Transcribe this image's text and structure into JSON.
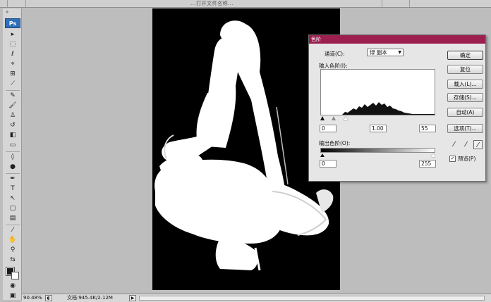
{
  "window": {
    "doc_title": "...打开文件名称..."
  },
  "toolbox": {
    "collapse": "»",
    "logo": "Ps",
    "tools": [
      {
        "name": "move-tool-icon",
        "glyph": "▸"
      },
      {
        "name": "marquee-tool-icon",
        "glyph": "⬚"
      },
      {
        "name": "lasso-tool-icon",
        "glyph": "ℓ"
      },
      {
        "name": "quick-select-tool-icon",
        "glyph": "⌖"
      },
      {
        "name": "crop-tool-icon",
        "glyph": "⊞"
      },
      {
        "name": "slice-tool-icon",
        "glyph": "⟋"
      },
      {
        "name": "healing-brush-icon",
        "glyph": "✎"
      },
      {
        "name": "brush-tool-icon",
        "glyph": "🖌"
      },
      {
        "name": "clone-stamp-icon",
        "glyph": "♙"
      },
      {
        "name": "history-brush-icon",
        "glyph": "↺"
      },
      {
        "name": "eraser-tool-icon",
        "glyph": "◧"
      },
      {
        "name": "gradient-tool-icon",
        "glyph": "▭"
      },
      {
        "name": "blur-tool-icon",
        "glyph": "◊"
      },
      {
        "name": "dodge-tool-icon",
        "glyph": "●"
      },
      {
        "name": "pen-tool-icon",
        "glyph": "✒"
      },
      {
        "name": "type-tool-icon",
        "glyph": "T"
      },
      {
        "name": "path-select-tool-icon",
        "glyph": "↖"
      },
      {
        "name": "shape-tool-icon",
        "glyph": "▢"
      },
      {
        "name": "notes-tool-icon",
        "glyph": "▤"
      },
      {
        "name": "eyedropper-tool-icon",
        "glyph": "⁄"
      },
      {
        "name": "hand-tool-icon",
        "glyph": "✋"
      },
      {
        "name": "zoom-tool-icon",
        "glyph": "⚲"
      },
      {
        "name": "swap-colors-icon",
        "glyph": "⇆"
      }
    ],
    "quickmask_glyph": "◉",
    "screen_mode_glyph": "▣"
  },
  "status": {
    "zoom": "90.48%",
    "doc_size": "文档:945.4K/2.12M",
    "arrow": "▶",
    "icon": "◐"
  },
  "levels": {
    "title": "色阶",
    "channel_label": "通道(C):",
    "channel_value": "绿 副本",
    "input_label": "输入色阶(I):",
    "input_black": "0",
    "input_gamma": "1.00",
    "input_white": "55",
    "output_label": "输出色阶(O):",
    "output_black": "0",
    "output_white": "255",
    "buttons": {
      "ok": "确定",
      "reset": "复位",
      "load": "载入(L)...",
      "save": "存储(S)...",
      "auto": "自动(A)",
      "options": "选项(T)..."
    },
    "preview_label": "预览(P)",
    "preview_checked": "✓"
  },
  "colors": {
    "dialog_title_bg": "#9b2050",
    "foreground": "#1a1a1a",
    "background": "#ffffff",
    "canvas": "#000000",
    "mask": "#ffffff"
  }
}
